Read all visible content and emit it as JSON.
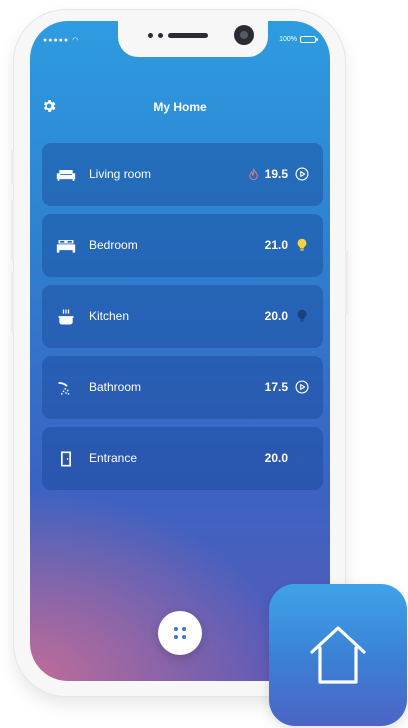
{
  "status_bar": {
    "signal": "●●●●● ",
    "battery": "100%"
  },
  "header": {
    "title": "My Home"
  },
  "rooms": [
    {
      "name": "Living room",
      "temperature": "19.5",
      "indicator": "flame-icon"
    },
    {
      "name": "Bedroom",
      "temperature": "21.0",
      "indicator": "bulb-on-icon"
    },
    {
      "name": "Kitchen",
      "temperature": "20.0",
      "indicator": "bulb-off-icon"
    },
    {
      "name": "Bathroom",
      "temperature": "17.5",
      "indicator": "play-icon"
    },
    {
      "name": "Entrance",
      "temperature": "20.0",
      "indicator": "play-dim-icon"
    }
  ],
  "colors": {
    "accent": "#3777cf",
    "bulb_on": "#f6d33c",
    "bulb_off": "#1d3f7e",
    "flame": "#e0758a"
  }
}
